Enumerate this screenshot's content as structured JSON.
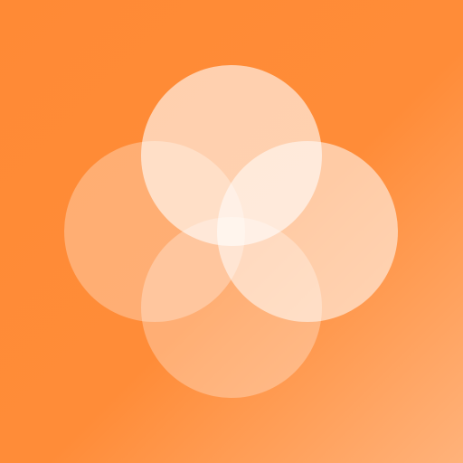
{
  "icon": {
    "name": "four-circle-flower-icon",
    "background_colors": [
      "#FF8A35",
      "#FF8C38",
      "#FFB27A"
    ],
    "petal_color": "#FFFFFF",
    "petals": [
      "top-petal",
      "left-petal",
      "right-petal",
      "bottom-petal"
    ]
  }
}
